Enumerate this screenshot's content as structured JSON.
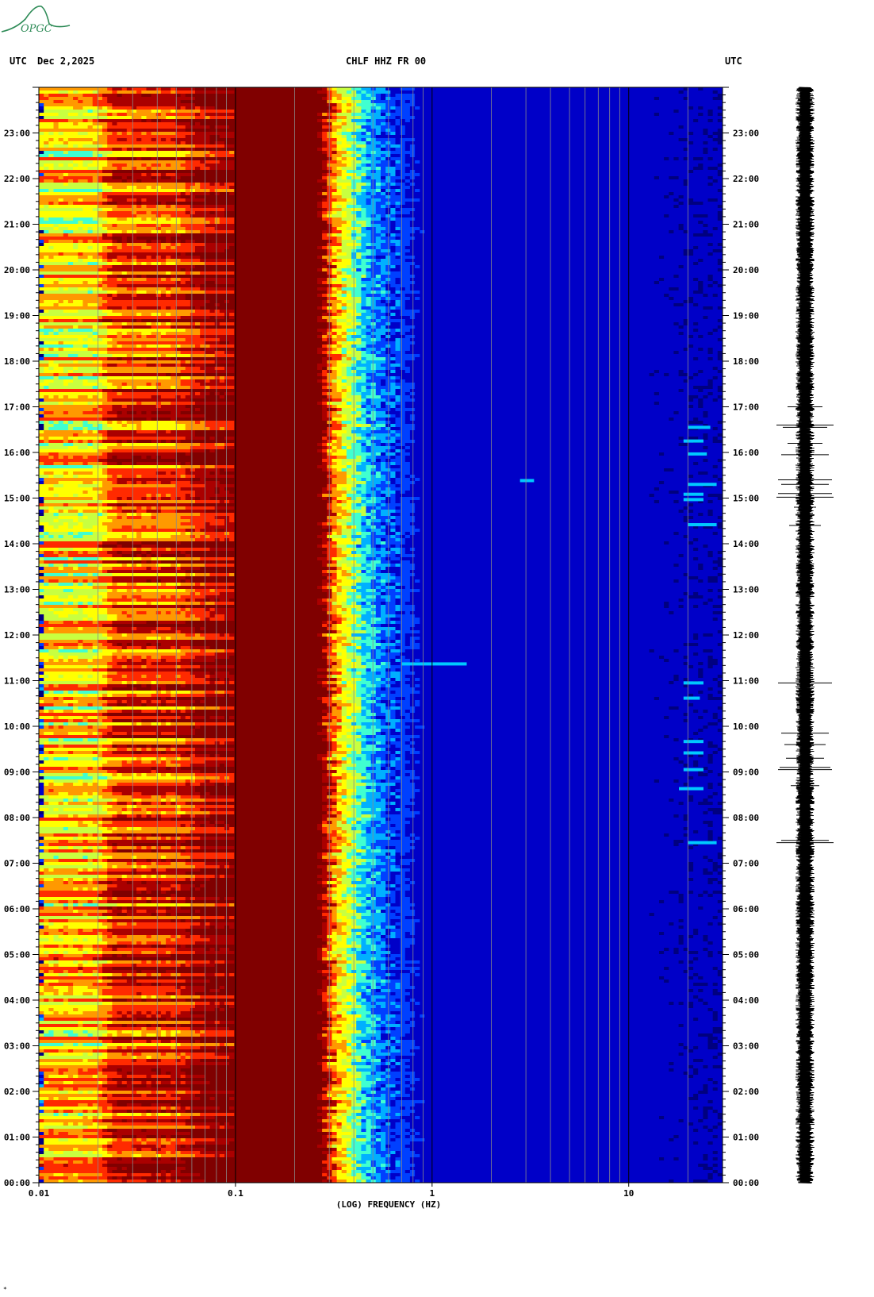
{
  "header": {
    "left_utc": "UTC",
    "date": "Dec 2,2025",
    "station": "CHLF HHZ FR 00",
    "right_utc": "UTC"
  },
  "logo": {
    "text": "OPGC",
    "icon": "observatory-logo-icon",
    "color": "#2e8b57"
  },
  "footer_mark": "*",
  "chart_data": {
    "type": "heatmap",
    "title": "CHLF HHZ FR 00",
    "xlabel": "(LOG) FREQUENCY (HZ)",
    "ylabel": "",
    "x_scale": "log",
    "xlim": [
      0.01,
      30
    ],
    "x_tick_labels": [
      "0.01",
      "0.1",
      "1",
      "10"
    ],
    "x_tick_values": [
      0.01,
      0.1,
      1,
      10
    ],
    "ylim": [
      "00:00",
      "24:00"
    ],
    "y_tick_labels": [
      "00:00",
      "01:00",
      "02:00",
      "03:00",
      "04:00",
      "05:00",
      "06:00",
      "07:00",
      "08:00",
      "09:00",
      "10:00",
      "11:00",
      "12:00",
      "13:00",
      "14:00",
      "15:00",
      "16:00",
      "17:00",
      "18:00",
      "19:00",
      "20:00",
      "21:00",
      "22:00",
      "23:00"
    ],
    "colorscale": [
      "#00007f",
      "#0000c8",
      "#0040ff",
      "#00b0ff",
      "#40ffd0",
      "#c8ff40",
      "#ffff00",
      "#ff9900",
      "#ff2a00",
      "#aa0000",
      "#800000"
    ],
    "spectral_profile": [
      {
        "freq": 0.01,
        "level": 0.62
      },
      {
        "freq": 0.02,
        "level": 0.62
      },
      {
        "freq": 0.024,
        "level": 0.8
      },
      {
        "freq": 0.05,
        "level": 0.8
      },
      {
        "freq": 0.072,
        "level": 0.93
      },
      {
        "freq": 0.1,
        "level": 0.97
      },
      {
        "freq": 0.27,
        "level": 1.0
      },
      {
        "freq": 0.33,
        "level": 0.65
      },
      {
        "freq": 0.45,
        "level": 0.35
      },
      {
        "freq": 0.6,
        "level": 0.2
      },
      {
        "freq": 1.0,
        "level": 0.1
      },
      {
        "freq": 30,
        "level": 0.06
      }
    ],
    "events": [
      {
        "time": "07:27",
        "freq_min": 20,
        "freq_max": 28
      },
      {
        "time": "08:38",
        "freq_min": 18,
        "freq_max": 24
      },
      {
        "time": "09:03",
        "freq_min": 19,
        "freq_max": 24
      },
      {
        "time": "09:25",
        "freq_min": 19,
        "freq_max": 24
      },
      {
        "time": "09:40",
        "freq_min": 19,
        "freq_max": 24
      },
      {
        "time": "10:37",
        "freq_min": 19,
        "freq_max": 23
      },
      {
        "time": "10:57",
        "freq_min": 19,
        "freq_max": 24
      },
      {
        "time": "11:22",
        "freq_min": 0.7,
        "freq_max": 1.5
      },
      {
        "time": "14:25",
        "freq_min": 20,
        "freq_max": 28
      },
      {
        "time": "14:58",
        "freq_min": 19,
        "freq_max": 24
      },
      {
        "time": "15:05",
        "freq_min": 19,
        "freq_max": 24
      },
      {
        "time": "15:18",
        "freq_min": 20,
        "freq_max": 28
      },
      {
        "time": "15:23",
        "freq_min": 2.8,
        "freq_max": 3.3
      },
      {
        "time": "15:58",
        "freq_min": 20,
        "freq_max": 25
      },
      {
        "time": "16:15",
        "freq_min": 19,
        "freq_max": 24
      },
      {
        "time": "16:33",
        "freq_min": 20,
        "freq_max": 26
      }
    ],
    "grid": true
  }
}
